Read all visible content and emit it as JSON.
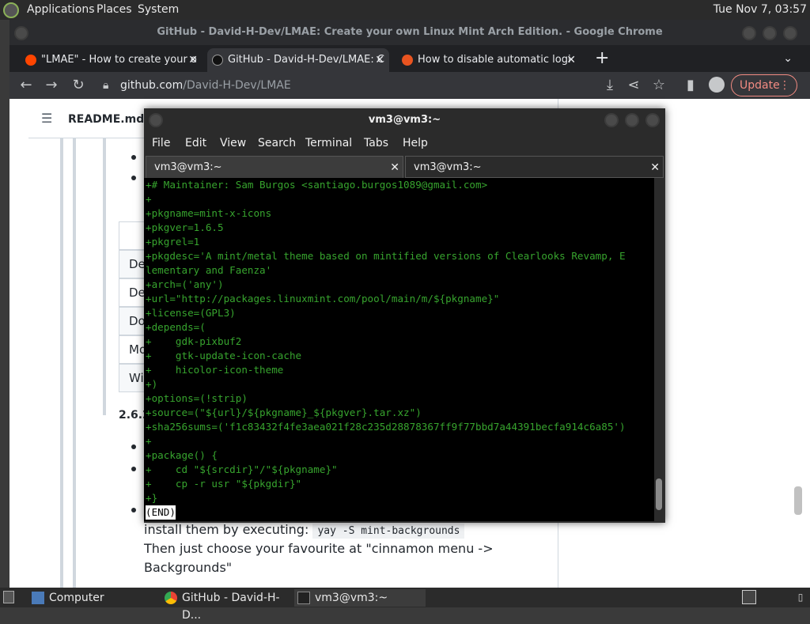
{
  "top_panel": {
    "menus": [
      "Applications",
      "Places",
      "System"
    ],
    "clock": "Tue Nov 7, 03:57"
  },
  "chrome": {
    "window_title": "GitHub - David-H-Dev/LMAE: Create your own Linux Mint Arch Edition. - Google Chrome",
    "tabs": [
      {
        "label": "\"LMAE\" - How to create your o"
      },
      {
        "label": "GitHub - David-H-Dev/LMAE: C"
      },
      {
        "label": "How to disable automatic logi"
      }
    ],
    "new_tab": "+",
    "url": {
      "host": "github.com",
      "path": "/David-H-Dev/LMAE"
    },
    "update_label": "Update"
  },
  "page": {
    "readme_title": "README.md",
    "table_cells": [
      "De",
      "De",
      "Do",
      "Mo",
      "Wi"
    ],
    "section_heading": "2.6.2",
    "install_text": "install them by executing:",
    "install_code": "yay -S mint-backgrounds",
    "choose_text": "Then just choose your favourite at \"cinnamon menu ->",
    "backgrounds_text": "Backgrounds\""
  },
  "terminal": {
    "title": "vm3@vm3:~",
    "menu": [
      "File",
      "Edit",
      "View",
      "Search",
      "Terminal",
      "Tabs",
      "Help"
    ],
    "tabs": [
      "vm3@vm3:~",
      "vm3@vm3:~"
    ],
    "lines": [
      "+# Maintainer: Sam Burgos <santiago.burgos1089@gmail.com>",
      "+",
      "+pkgname=mint-x-icons",
      "+pkgver=1.6.5",
      "+pkgrel=1",
      "+pkgdesc='A mint/metal theme based on mintified versions of Clearlooks Revamp, E",
      "lementary and Faenza'",
      "+arch=('any')",
      "+url=\"http://packages.linuxmint.com/pool/main/m/${pkgname}\"",
      "+license=(GPL3)",
      "+depends=(",
      "+    gdk-pixbuf2",
      "+    gtk-update-icon-cache",
      "+    hicolor-icon-theme",
      "+)",
      "+options=(!strip)",
      "+source=(\"${url}/${pkgname}_${pkgver}.tar.xz\")",
      "+sha256sums=('f1c83432f4fe3aea021f28c235d28878367ff9f77bbd7a44391becfa914c6a85')",
      "+",
      "+package() {",
      "+    cd \"${srcdir}\"/\"${pkgname}\"",
      "+    cp -r usr \"${pkgdir}\"",
      "+}"
    ],
    "end_marker": "(END)"
  },
  "taskbar": {
    "items": [
      "Computer",
      "GitHub - David-H-D...",
      "vm3@vm3:~"
    ]
  },
  "colors": {
    "terminal_text": "#37a42e",
    "update_accent": "#f28b82"
  }
}
